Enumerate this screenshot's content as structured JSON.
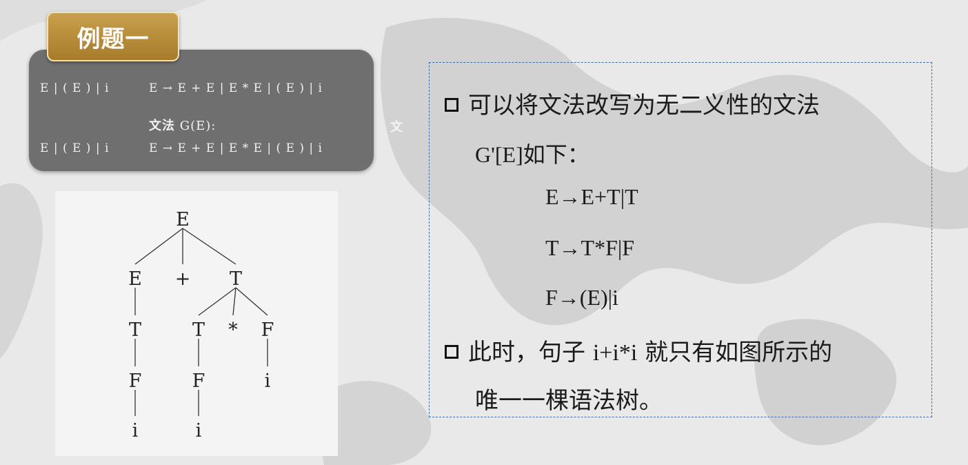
{
  "badge": {
    "label": "例题一"
  },
  "grammar_panel": {
    "left_fragment_1": "E | ( E ) | i",
    "rule_1": "E → E + E | E * E | ( E ) | i",
    "title_cn": "文法",
    "title_sym": "G(E):",
    "left_fragment_2": "E | ( E ) | i",
    "rule_2": "E → E + E | E * E | ( E ) | i",
    "right_glimpse_1": "文",
    "right_glimpse_2": "文"
  },
  "parse_tree": {
    "nodes": [
      {
        "id": "root",
        "label": "E"
      },
      {
        "id": "E1",
        "label": "E"
      },
      {
        "id": "plus",
        "label": "+"
      },
      {
        "id": "T1",
        "label": "T"
      },
      {
        "id": "T2",
        "label": "T"
      },
      {
        "id": "T3",
        "label": "T"
      },
      {
        "id": "star",
        "label": "*"
      },
      {
        "id": "F3",
        "label": "F"
      },
      {
        "id": "F1",
        "label": "F"
      },
      {
        "id": "F2",
        "label": "F"
      },
      {
        "id": "i3",
        "label": "i"
      },
      {
        "id": "i1",
        "label": "i"
      },
      {
        "id": "i2",
        "label": "i"
      }
    ],
    "edges": [
      [
        "root",
        "E1"
      ],
      [
        "root",
        "plus"
      ],
      [
        "root",
        "T1"
      ],
      [
        "E1",
        "T2"
      ],
      [
        "T1",
        "T3"
      ],
      [
        "T1",
        "star"
      ],
      [
        "T1",
        "F3"
      ],
      [
        "T2",
        "F1"
      ],
      [
        "T3",
        "F2"
      ],
      [
        "F3",
        "i3"
      ],
      [
        "F1",
        "i1"
      ],
      [
        "F2",
        "i2"
      ]
    ]
  },
  "text_box": {
    "line1": "可以将文法改写为无二义性的文法",
    "line2_sym": "G'[E]",
    "line2_cn": "如下：",
    "rule_1": "E→E+T|T",
    "rule_2": "T→T*F|F",
    "rule_3": "F→(E)|i",
    "line3_a": "此时，句子 ",
    "line3_sym": "i+i*i",
    "line3_b": " 就只有如图所示的",
    "line4": "唯一一棵语法树。"
  },
  "colors": {
    "badge": "#b68a37",
    "panel": "#6f6f6f",
    "dashed_border": "#3a6aa8"
  }
}
